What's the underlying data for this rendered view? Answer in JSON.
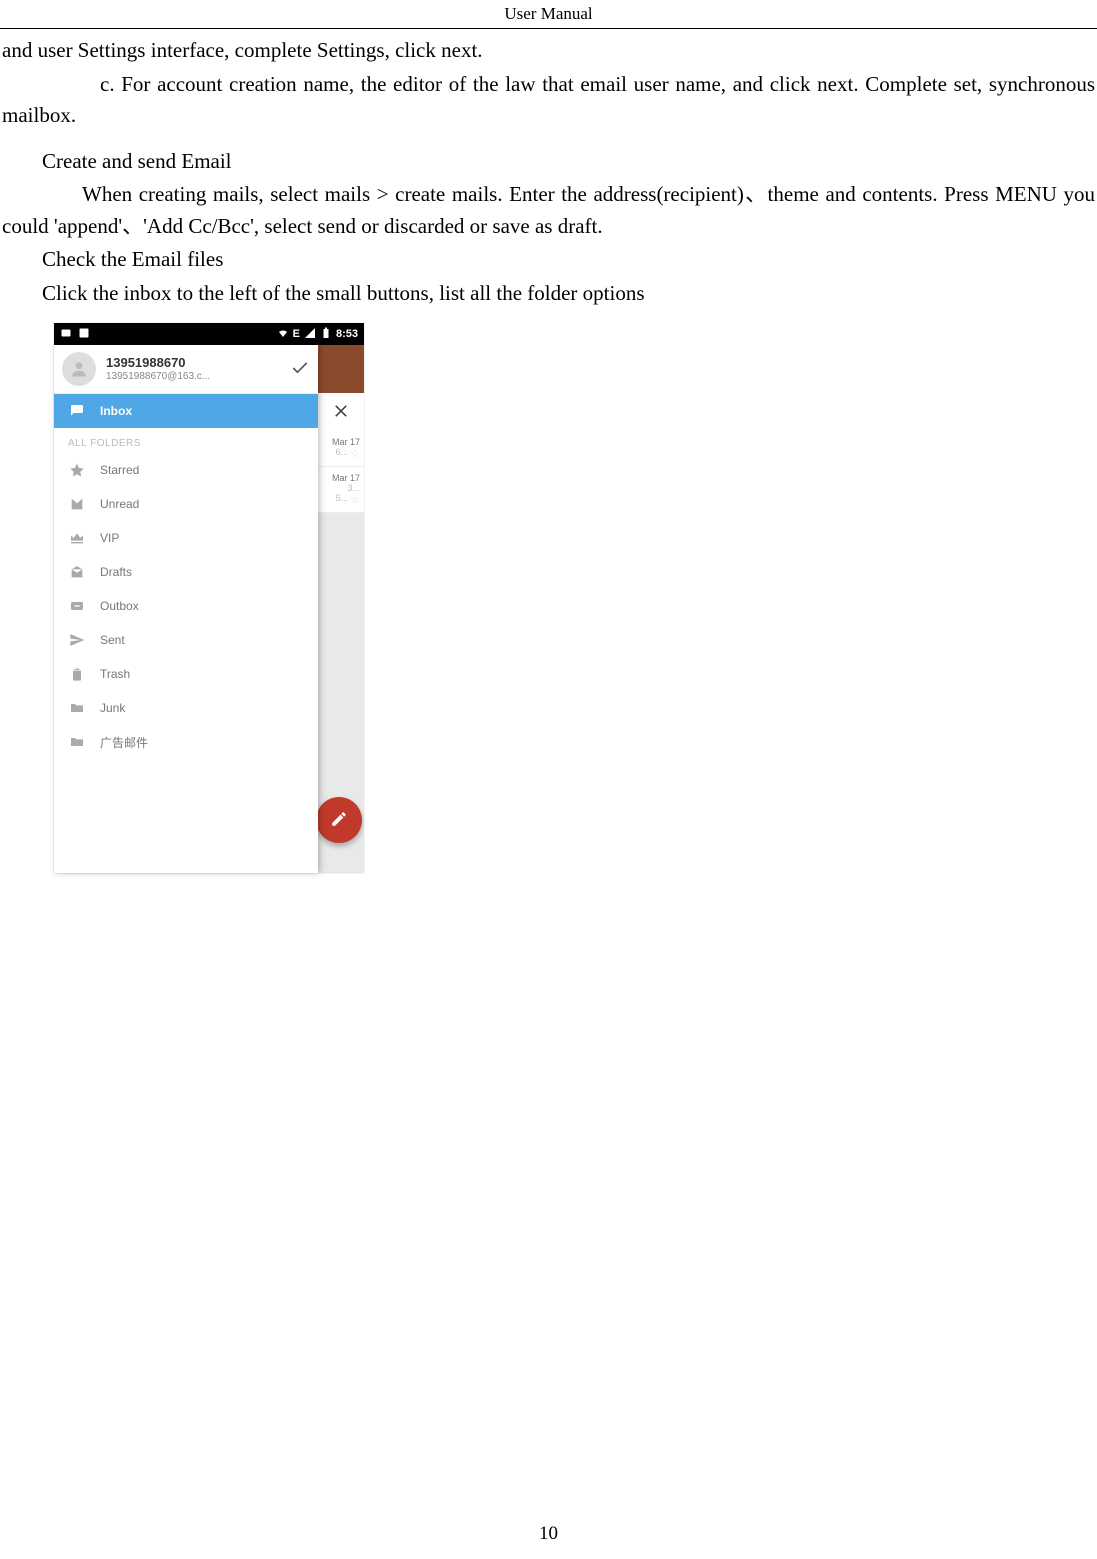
{
  "header": {
    "title": "User    Manual"
  },
  "page_number": "10",
  "paragraphs": {
    "p1": "and user Settings interface, complete Settings, click next.",
    "p2": "c. For account creation name, the editor of the law that email user name, and click next. Complete set, synchronous mailbox.",
    "p3": "Create and send Email",
    "p4": "When creating mails, select mails > create mails. Enter the address(recipient)、theme and contents. Press MENU you could 'append'、'Add Cc/Bcc',    select send or discarded or save as draft.",
    "p5": "Check the Email files",
    "p6": "Click the inbox to the left of the small buttons, list all the folder options"
  },
  "statusbar": {
    "signal": "E",
    "time": "8:53"
  },
  "account": {
    "name": "13951988670",
    "email": "13951988670@163.c..."
  },
  "drawer": {
    "inbox": "Inbox",
    "section_label": "ALL FOLDERS",
    "items": [
      {
        "label": "Starred"
      },
      {
        "label": "Unread"
      },
      {
        "label": "VIP"
      },
      {
        "label": "Drafts"
      },
      {
        "label": "Outbox"
      },
      {
        "label": "Sent"
      },
      {
        "label": "Trash"
      },
      {
        "label": "Junk"
      },
      {
        "label": "广告邮件"
      }
    ]
  },
  "mail_rows": [
    {
      "date": "Mar 17",
      "snip": "6...",
      "star": "☆"
    },
    {
      "date": "Mar 17",
      "snip2": "3...",
      "snip": "5...",
      "star": "☆"
    }
  ]
}
